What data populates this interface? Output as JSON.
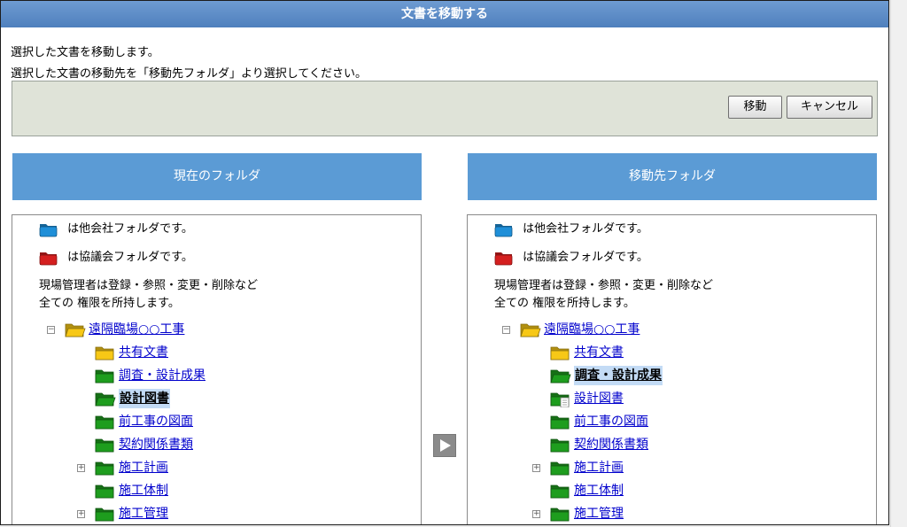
{
  "dialog": {
    "title": "文書を移動する",
    "instruction_line1": "選択した文書を移動します。",
    "instruction_line2": "選択した文書の移動先を「移動先フォルダ」より選択してください。",
    "move_label": "移動",
    "cancel_label": "キャンセル"
  },
  "colors": {
    "title_bar": "#5b8cc7",
    "panel_header": "#5b9bd5",
    "action_bar": "#dfe3d8",
    "link": "#0000cc",
    "selected_bg": "#c3dbf5",
    "folder_yellow": "#f7c816",
    "folder_green": "#1e9d1e",
    "folder_blue": "#1f8fd8",
    "folder_red": "#d41f1f"
  },
  "left_panel": {
    "header": "現在のフォルダ",
    "legend_other": "は他会社フォルダです。",
    "legend_assoc": "は協議会フォルダです。",
    "note_line1": "現場管理者は登録・参照・変更・削除など",
    "note_line2": "全ての 権限を所持します。",
    "tree": [
      {
        "label": "遠隔臨場○○工事",
        "icon": "folder-open-yellow-icon",
        "level": 0,
        "expander": "minus",
        "selected": false
      },
      {
        "label": "共有文書",
        "icon": "folder-yellow-icon",
        "level": 1,
        "expander": "",
        "selected": false
      },
      {
        "label": "調査・設計成果",
        "icon": "folder-green-icon",
        "level": 1,
        "expander": "",
        "selected": false
      },
      {
        "label": "設計図書",
        "icon": "folder-open-green-icon",
        "level": 1,
        "expander": "",
        "selected": true
      },
      {
        "label": "前工事の図面",
        "icon": "folder-green-icon",
        "level": 1,
        "expander": "",
        "selected": false
      },
      {
        "label": "契約関係書類",
        "icon": "folder-green-icon",
        "level": 1,
        "expander": "",
        "selected": false
      },
      {
        "label": "施工計画",
        "icon": "folder-green-icon",
        "level": 1,
        "expander": "plus",
        "selected": false
      },
      {
        "label": "施工体制",
        "icon": "folder-green-icon",
        "level": 1,
        "expander": "",
        "selected": false
      },
      {
        "label": "施工管理",
        "icon": "folder-green-icon",
        "level": 1,
        "expander": "plus",
        "selected": false
      }
    ]
  },
  "right_panel": {
    "header": "移動先フォルダ",
    "legend_other": "は他会社フォルダです。",
    "legend_assoc": "は協議会フォルダです。",
    "note_line1": "現場管理者は登録・参照・変更・削除など",
    "note_line2": "全ての 権限を所持します。",
    "tree": [
      {
        "label": "遠隔臨場○○工事",
        "icon": "folder-open-yellow-icon",
        "level": 0,
        "expander": "minus",
        "selected": false
      },
      {
        "label": "共有文書",
        "icon": "folder-yellow-icon",
        "level": 1,
        "expander": "",
        "selected": false
      },
      {
        "label": "調査・設計成果",
        "icon": "folder-open-green-icon",
        "level": 1,
        "expander": "",
        "selected": true
      },
      {
        "label": "設計図書",
        "icon": "folder-green-doc-icon",
        "level": 1,
        "expander": "",
        "selected": false
      },
      {
        "label": "前工事の図面",
        "icon": "folder-green-icon",
        "level": 1,
        "expander": "",
        "selected": false
      },
      {
        "label": "契約関係書類",
        "icon": "folder-green-icon",
        "level": 1,
        "expander": "",
        "selected": false
      },
      {
        "label": "施工計画",
        "icon": "folder-green-icon",
        "level": 1,
        "expander": "plus",
        "selected": false
      },
      {
        "label": "施工体制",
        "icon": "folder-green-icon",
        "level": 1,
        "expander": "",
        "selected": false
      },
      {
        "label": "施工管理",
        "icon": "folder-green-icon",
        "level": 1,
        "expander": "plus",
        "selected": false
      }
    ]
  }
}
